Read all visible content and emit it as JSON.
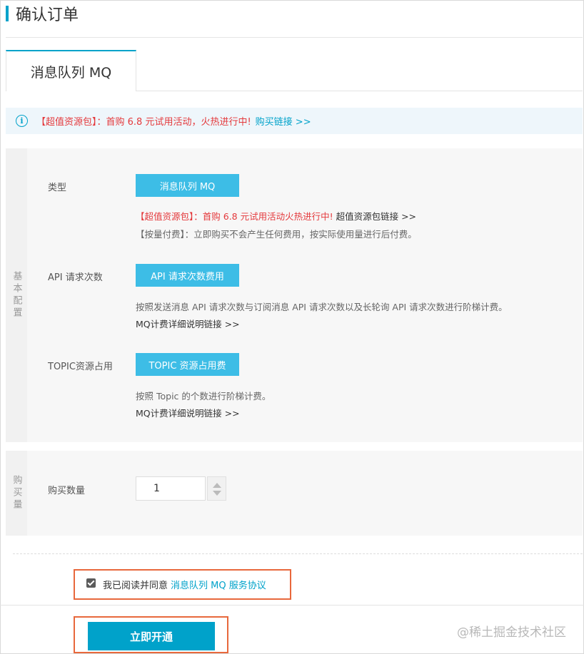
{
  "page": {
    "title": "确认订单"
  },
  "tab": {
    "label": "消息队列 MQ"
  },
  "notice": {
    "prefix": "【超值资源包】：",
    "text": "首购 6.8 元试用活动，火热进行中!",
    "link": "购买链接 >>"
  },
  "basic_section": {
    "label": "基本配置",
    "type_row": {
      "label": "类型",
      "button": "消息队列 MQ",
      "promo_prefix": "【超值资源包】：",
      "promo_text": "首购 6.8 元试用活动火热进行中!",
      "promo_link": "超值资源包链接 >>",
      "billing_prefix": "【按量付费】：",
      "billing_text": "立即购买不会产生任何费用，按实际使用量进行后付费。"
    },
    "api_row": {
      "label": "API 请求次数",
      "button": "API 请求次数费用",
      "desc": "按照发送消息 API 请求次数与订阅消息 API 请求次数以及长轮询 API 请求次数进行阶梯计费。",
      "link": "MQ计费详细说明链接 >>"
    },
    "topic_row": {
      "label": "TOPIC资源占用",
      "button": "TOPIC 资源占用费",
      "desc": "按照 Topic 的个数进行阶梯计费。",
      "link": "MQ计费详细说明链接 >>"
    }
  },
  "purchase_section": {
    "label": "购买量",
    "qty_label": "购买数量",
    "qty_value": "1"
  },
  "agreement": {
    "text": "我已阅读并同意",
    "link": "消息队列 MQ 服务协议",
    "checked": true
  },
  "submit": {
    "label": "立即开通"
  },
  "watermark": "@稀土掘金技术社区",
  "colors": {
    "accent": "#00a2ca",
    "button": "#3dbde6",
    "highlight_border": "#e8683c",
    "promo_red": "#e4393c"
  }
}
